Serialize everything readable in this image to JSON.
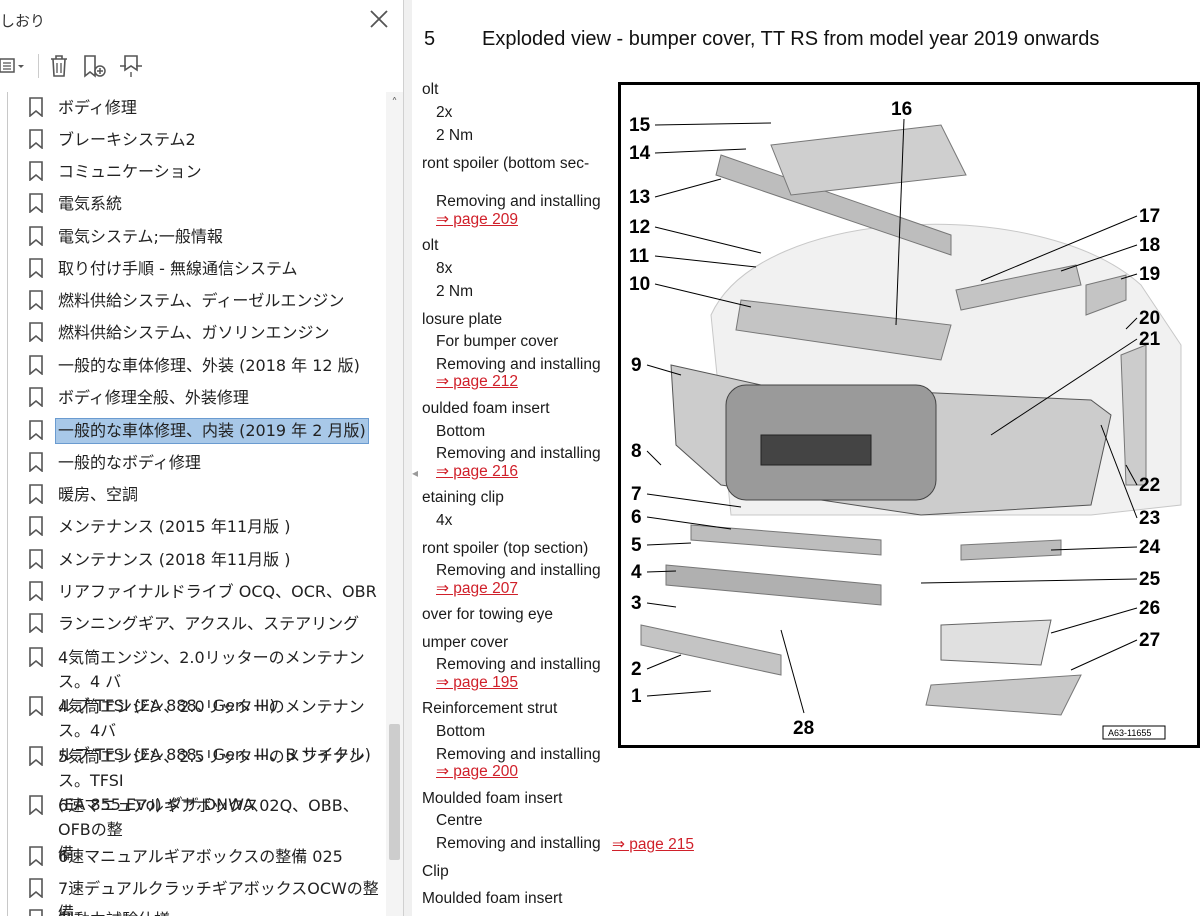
{
  "sidebar": {
    "title": "しおり",
    "items": [
      {
        "label": "ボディ修理"
      },
      {
        "label": "ブレーキシステム2"
      },
      {
        "label": "コミュニケーション"
      },
      {
        "label": "電気系統"
      },
      {
        "label": "電気システム;一般情報"
      },
      {
        "label": "取り付け手順 - 無線通信システム"
      },
      {
        "label": "燃料供給システム、ディーゼルエンジン"
      },
      {
        "label": "燃料供給システム、ガソリンエンジン"
      },
      {
        "label": "一般的な車体修理、外装 (2018 年 12 版)"
      },
      {
        "label": "ボディ修理全般、外装修理"
      },
      {
        "label": "一般的な車体修理、内装 (2019 年 2 月版)"
      },
      {
        "label": "一般的なボディ修理"
      },
      {
        "label": "暖房、空調"
      },
      {
        "label": "メンテナンス (2015 年11月版 )"
      },
      {
        "label": "メンテナンス (2018 年11月版 )"
      },
      {
        "label": "リアファイナルドライブ OCQ、OCR、OBR"
      },
      {
        "label": "ランニングギア、アクスル、ステアリング"
      },
      {
        "line1": "4気筒エンジン、2.0リッターのメンテナンス。4 バ",
        "line2": "ルブ TFSI (EA 888、Gen. III)"
      },
      {
        "line1": "4気筒エンジン、2.0リッターのメンテナンス。4バ",
        "line2": "ルブ TFSI (EA 888、Gen. III、B サイクル)"
      },
      {
        "line1": "5気筒エンジン、2.5リッターのメンテナンス。TFSI",
        "line2": "(EA 855 Evo) ダザ DNWA"
      },
      {
        "line1": "6速マニュアルギアボックス02Q、OBB、OFBの整",
        "line2": "備"
      },
      {
        "label": "6速マニュアルギアボックスの整備 025"
      },
      {
        "label": "7速デュアルクラッチギアボックスOCWの整備"
      },
      {
        "label": "制動力試験仕様"
      }
    ],
    "selected_index": 10
  },
  "document": {
    "section_number": "5",
    "title": "Exploded view - bumper cover, TT RS from model year 2019 onwards",
    "lines": [
      "olt",
      "2x",
      "2 Nm",
      "ront spoiler (bottom sec-",
      "Removing and installing",
      "⇒ page 209",
      "olt",
      "8x",
      "2 Nm",
      "losure plate",
      "For bumper cover",
      "Removing and installing",
      "⇒ page 212",
      "oulded foam insert",
      "Bottom",
      "Removing and installing",
      "⇒ page 216",
      "etaining clip",
      "4x",
      "ront spoiler (top section)",
      "Removing and installing",
      "⇒ page 207",
      "over for towing eye",
      "umper cover",
      "Removing and installing",
      "⇒ page 195",
      "Reinforcement strut",
      "Bottom",
      "Removing and installing",
      "⇒ page 200",
      "Moulded foam insert",
      "Centre",
      "Removing and installing",
      "⇒ page 215",
      "Clip",
      "Moulded foam insert"
    ]
  },
  "figure": {
    "labels": [
      "1",
      "2",
      "3",
      "4",
      "5",
      "6",
      "7",
      "8",
      "9",
      "10",
      "11",
      "12",
      "13",
      "14",
      "15",
      "16",
      "17",
      "18",
      "19",
      "20",
      "21",
      "22",
      "23",
      "24",
      "25",
      "26",
      "27",
      "28"
    ],
    "reference": "A63-11655"
  },
  "colors": {
    "selection": "#a8c8e8",
    "link": "#d0202a"
  }
}
